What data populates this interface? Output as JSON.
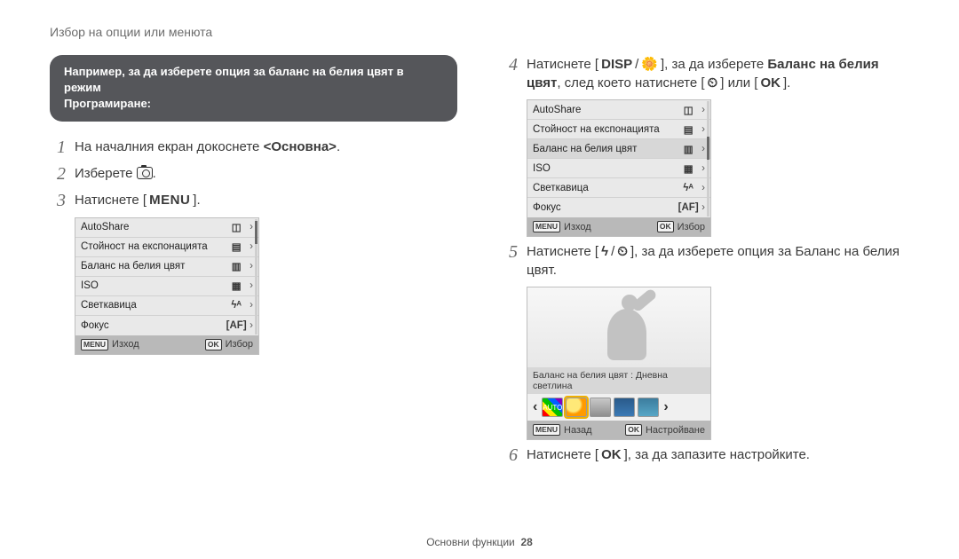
{
  "header": {
    "title": "Избор на опции или менюта"
  },
  "pill": {
    "line1": "Например, за да изберете опция за баланс на белия цвят в режим",
    "line2": "Програмиране:"
  },
  "left": {
    "step1": {
      "pre": "На началния екран докоснете ",
      "bold": "<Основна>",
      "post": "."
    },
    "step2": {
      "text": "Изберете "
    },
    "step3": {
      "pre": "Натиснете [",
      "key": "MENU",
      "post": "]."
    },
    "menu": {
      "rows": [
        {
          "label": "AutoShare",
          "val": "◫"
        },
        {
          "label": "Стойност на експонацията",
          "val": "▤"
        },
        {
          "label": "Баланс на белия цвят",
          "val": "▥"
        },
        {
          "label": "ISO",
          "val": "▦"
        },
        {
          "label": "Светкавица",
          "val": "ϟᴬ"
        },
        {
          "label": "Фокус",
          "val": "[AF]"
        }
      ],
      "foot": {
        "leftKey": "MENU",
        "leftLabel": "Изход",
        "rightKey": "OK",
        "rightLabel": "Избор"
      },
      "selected_index": -1
    }
  },
  "right": {
    "step4": {
      "pre": "Натиснете [",
      "k1": "DISP",
      "sep": "/",
      "k2": "🌼",
      "mid": "], за да изберете ",
      "bold": "Баланс на белия цвят",
      "mid2": ", след което натиснете [",
      "k3": "⏲",
      "mid3": "] или [",
      "k4": "OK",
      "post": "]."
    },
    "menu": {
      "rows": [
        {
          "label": "AutoShare",
          "val": "◫"
        },
        {
          "label": "Стойност на експонацията",
          "val": "▤"
        },
        {
          "label": "Баланс на белия цвят",
          "val": "▥"
        },
        {
          "label": "ISO",
          "val": "▦"
        },
        {
          "label": "Светкавица",
          "val": "ϟᴬ"
        },
        {
          "label": "Фокус",
          "val": "[AF]"
        }
      ],
      "foot": {
        "leftKey": "MENU",
        "leftLabel": "Изход",
        "rightKey": "OK",
        "rightLabel": "Избор"
      },
      "selected_index": 2
    },
    "step5": {
      "pre": "Натиснете [",
      "k1": "ϟ",
      "sep": "/",
      "k2": "⏲",
      "post": "], за да изберете опция за Баланс на белия цвят."
    },
    "wb": {
      "preview_label": "Баланс на белия цвят : Дневна светлина",
      "chips": [
        {
          "bg": "linear-gradient(45deg,#ff0000 0 20%,#ffea00 20% 40%,#00c000 40% 60%,#0060ff 60% 80%,#8000c0 80% 100%)",
          "text": "AUTO"
        },
        {
          "bg": "radial-gradient(circle at 35% 35%, #ffe978 0 40%, #ff9a00 55% 100%)",
          "text": ""
        },
        {
          "bg": "linear-gradient(#c8c8c8,#8f8f8f)",
          "text": ""
        },
        {
          "bg": "linear-gradient(#2a5a8a,#3b7ab5)",
          "text": ""
        },
        {
          "bg": "linear-gradient(#3c7d9e,#56a6c6)",
          "text": ""
        }
      ],
      "selected_chip": 1,
      "foot": {
        "leftKey": "MENU",
        "leftLabel": "Назад",
        "rightKey": "OK",
        "rightLabel": "Настройване"
      }
    },
    "step6": {
      "pre": "Натиснете [",
      "k1": "OK",
      "post": "], за да запазите настройките."
    }
  },
  "footer": {
    "section": "Основни функции",
    "page": "28"
  }
}
